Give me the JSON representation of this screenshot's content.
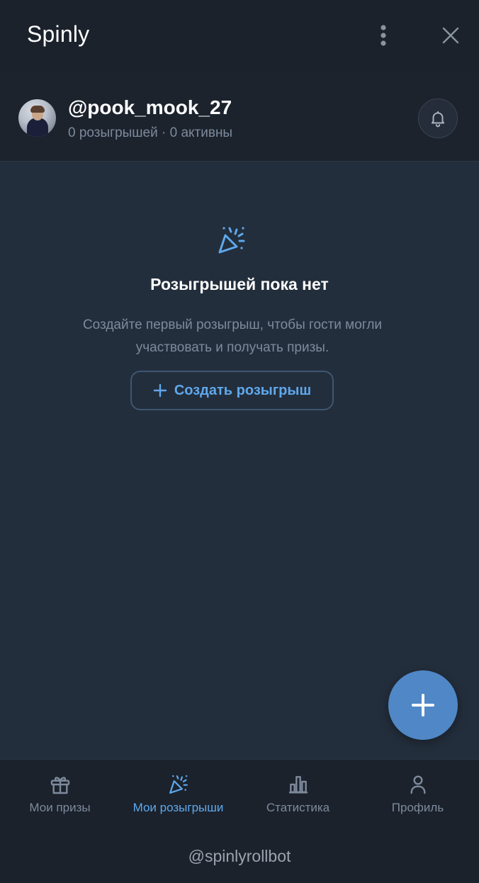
{
  "app": {
    "title": "Spinly"
  },
  "profile": {
    "username": "@pook_mook_27",
    "stats": "0 розыгрышей · 0 активны"
  },
  "empty_state": {
    "icon": "party-popper-icon",
    "title": "Розыгрышей пока нет",
    "description": "Создайте первый розыгрыш, чтобы гости могли участвовать и получать призы.",
    "button_label": "Создать розыгрыш"
  },
  "bottom_nav": {
    "items": [
      {
        "label": "Мои призы",
        "icon": "gift-icon",
        "active": false
      },
      {
        "label": "Мои розыгрыши",
        "icon": "party-popper-icon",
        "active": true
      },
      {
        "label": "Статистика",
        "icon": "bar-chart-icon",
        "active": false
      },
      {
        "label": "Профиль",
        "icon": "user-icon",
        "active": false
      }
    ]
  },
  "footer": {
    "bot_handle": "@spinlyrollbot"
  },
  "colors": {
    "background": "#1b222c",
    "content": "#232e3c",
    "accent": "#5fa8ec",
    "fab": "#5088c7",
    "muted_text": "#7d8a9c"
  }
}
